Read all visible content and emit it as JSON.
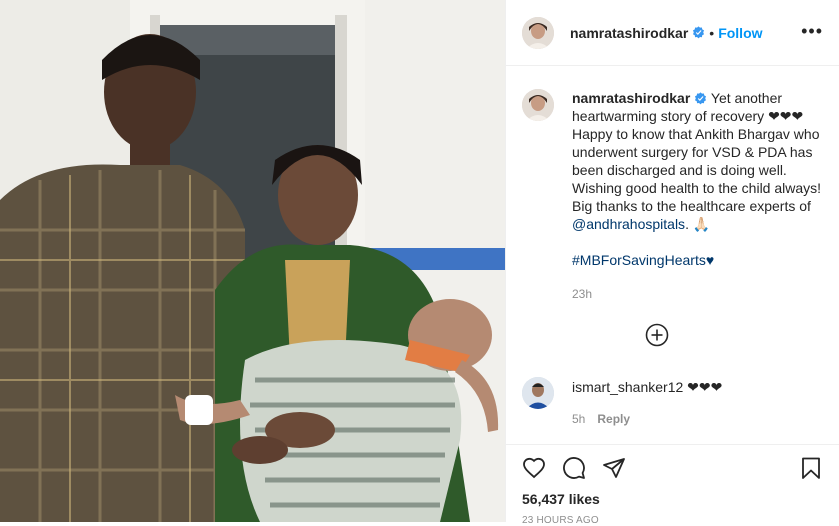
{
  "post": {
    "username": "namratashirodkar",
    "follow_label": "Follow",
    "separator": "•",
    "more_label": "•••"
  },
  "caption": {
    "username": "namratashirodkar",
    "text": " Yet another heartwarming story of recovery ❤❤❤\nHappy to know that Ankith Bhargav who underwent surgery for VSD & PDA has been discharged and is doing well. Wishing good health to the child always! Big thanks to the healthcare experts of ",
    "mention": "@andhrahospitals",
    "after_mention": ". 🙏🏻",
    "hashtag": "#MBForSavingHearts♥",
    "time": "23h"
  },
  "comment": {
    "username": "ismart_shanker12",
    "text": "❤❤❤",
    "time": "5h",
    "reply_label": "Reply"
  },
  "actions": {
    "likes": "56,437 likes",
    "posted_ago": "23 HOURS AGO"
  },
  "colors": {
    "accent": "#0095f6",
    "link": "#00376b",
    "verified": "#3897f0",
    "muted": "#8e8e8e"
  },
  "icons": [
    "verified-badge-icon",
    "more-options-icon",
    "load-more-comments-icon",
    "heart-icon",
    "comment-icon",
    "share-icon",
    "bookmark-icon"
  ]
}
